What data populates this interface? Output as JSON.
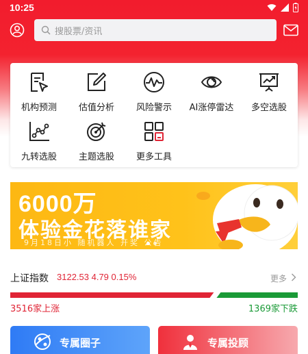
{
  "status_bar": {
    "time": "10:25"
  },
  "search": {
    "placeholder": "搜股票/资讯"
  },
  "tools": [
    {
      "label": "机构预测",
      "icon": "institution-forecast-icon"
    },
    {
      "label": "估值分析",
      "icon": "valuation-edit-icon"
    },
    {
      "label": "风险警示",
      "icon": "risk-wave-icon"
    },
    {
      "label": "AI涨停雷达",
      "icon": "radar-eye-icon"
    },
    {
      "label": "多空选股",
      "icon": "board-trend-icon"
    },
    {
      "label": "九转选股",
      "icon": "scatter-chart-icon"
    },
    {
      "label": "主题选股",
      "icon": "target-arrow-icon"
    },
    {
      "label": "更多工具",
      "icon": "grid-tools-icon"
    }
  ],
  "banner": {
    "line1": "6000万",
    "line2": "体验金花落谁家",
    "line3": "9月18日小 随机器人 开奖 公告"
  },
  "market_index": {
    "name": "上证指数",
    "values": "3122.53 4.79 0.15%",
    "more": "更多",
    "advancers": "3516家上涨",
    "decliners": "1369家下跌",
    "advance_ratio": 0.72
  },
  "actions": {
    "circle_label": "专属圈子",
    "advisor_label": "专属投顾"
  },
  "colors": {
    "brand_red": "#f21c2d",
    "up_red": "#e02435",
    "down_green": "#1a9a37",
    "banner_yellow": "#fdb813"
  }
}
